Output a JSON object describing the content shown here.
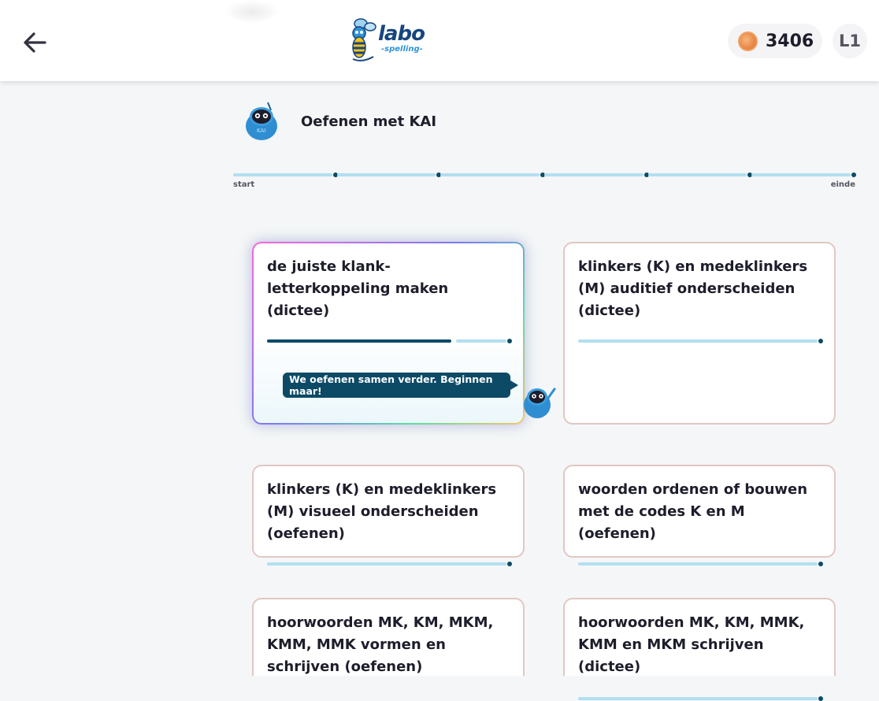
{
  "header": {
    "logo_main": "labo",
    "logo_sub": "-spelling-",
    "coins": "3406",
    "level": "L1"
  },
  "kai": {
    "title": "Oefenen met KAI"
  },
  "progress": {
    "start_label": "start",
    "end_label": "einde",
    "segments": 6
  },
  "cards": [
    {
      "title": "de juiste klank-letterkoppeling maken (dictee)",
      "progress_done": 0.76
    },
    {
      "title": "klinkers (K) en medeklinkers (M) auditief onderscheiden (dictee)",
      "progress_done": 0
    },
    {
      "title": "klinkers (K) en medeklinkers (M) visueel onderscheiden (oefenen)",
      "progress_done": 0
    },
    {
      "title": "woorden ordenen of bouwen met de codes K en M (oefenen)",
      "progress_done": 0
    },
    {
      "title": "hoorwoorden MK, KM, MKM, KMM, MMK vormen en schrijven (oefenen)",
      "progress_done": 0
    },
    {
      "title": "hoorwoorden MK, KM, MMK, KMM en MKM schrijven (dictee)",
      "progress_done": 0
    }
  ],
  "bubble": {
    "text": "We oefenen samen verder. Beginnen maar!"
  },
  "colors": {
    "accent_dark": "#0c4a66",
    "accent_light": "#b2dff0",
    "card_border": "#e0c8c2"
  }
}
